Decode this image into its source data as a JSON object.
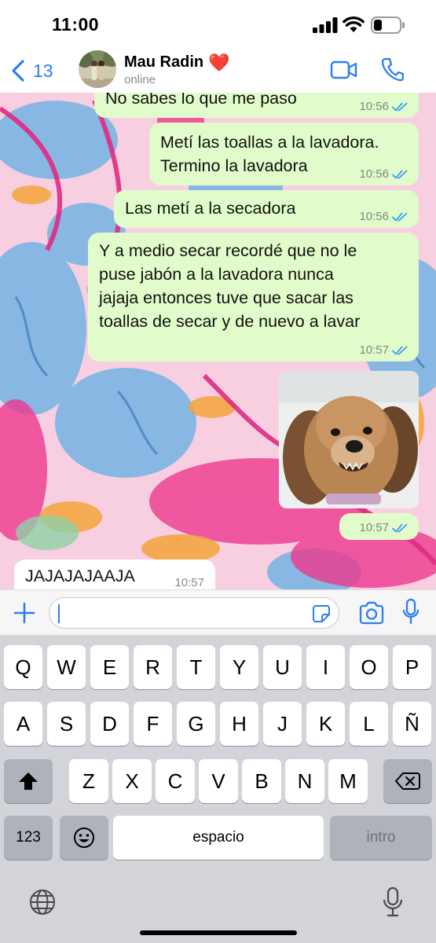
{
  "status_bar": {
    "time": "11:00"
  },
  "header": {
    "back_count": "13",
    "contact_name": "Mau Radin",
    "contact_emoji": "❤️",
    "presence": "online",
    "icons": [
      "chevron-left-icon",
      "video-call-icon",
      "phone-call-icon"
    ]
  },
  "messages": [
    {
      "direction": "outgoing",
      "text": "No sabes lo que me paso",
      "time": "10:56",
      "status": "read"
    },
    {
      "direction": "outgoing",
      "text": "Metí las toallas a la lavadora.\nTermino la lavadora",
      "time": "10:56",
      "status": "read"
    },
    {
      "direction": "outgoing",
      "text": "Las metí a la secadora",
      "time": "10:56",
      "status": "read"
    },
    {
      "direction": "outgoing",
      "text": "Y a medio secar recordé que no le\npuse jabón a la lavadora nunca\njajaja entonces tuve que sacar las\ntoallas de secar y de nuevo a lavar",
      "time": "10:57",
      "status": "read"
    },
    {
      "direction": "outgoing",
      "type": "sticker",
      "time": "10:57",
      "status": "read"
    },
    {
      "direction": "incoming",
      "text": "JAJAJAJAAJA",
      "time": "10:57"
    }
  ],
  "composer": {
    "text": ""
  },
  "keyboard": {
    "row1": [
      "Q",
      "W",
      "E",
      "R",
      "T",
      "Y",
      "U",
      "I",
      "O",
      "P"
    ],
    "row2": [
      "A",
      "S",
      "D",
      "F",
      "G",
      "H",
      "J",
      "K",
      "L",
      "Ñ"
    ],
    "row3": [
      "Z",
      "X",
      "C",
      "V",
      "B",
      "N",
      "M"
    ],
    "numbers_key": "123",
    "space_key": "espacio",
    "return_key": "intro"
  },
  "colors": {
    "accent": "#2a7ef0",
    "outgoing_bubble": "#e1fcca",
    "incoming_bubble": "#ffffff",
    "read_ticks": "#3c9ef2"
  }
}
